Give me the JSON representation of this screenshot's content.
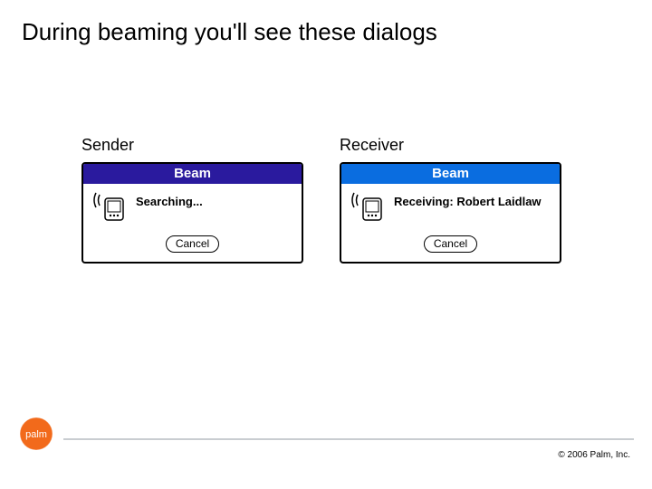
{
  "title": "During beaming you'll see these dialogs",
  "sender": {
    "label": "Sender",
    "dialog_title": "Beam",
    "status": "Searching...",
    "cancel": "Cancel"
  },
  "receiver": {
    "label": "Receiver",
    "dialog_title": "Beam",
    "status": "Receiving: Robert Laidlaw",
    "cancel": "Cancel"
  },
  "footer": {
    "brand": "palm",
    "copyright": "© 2006 Palm, Inc."
  },
  "colors": {
    "sender_title_bg": "#2a1a9e",
    "receiver_title_bg": "#0a6de0",
    "logo_orange": "#f26a1b"
  }
}
